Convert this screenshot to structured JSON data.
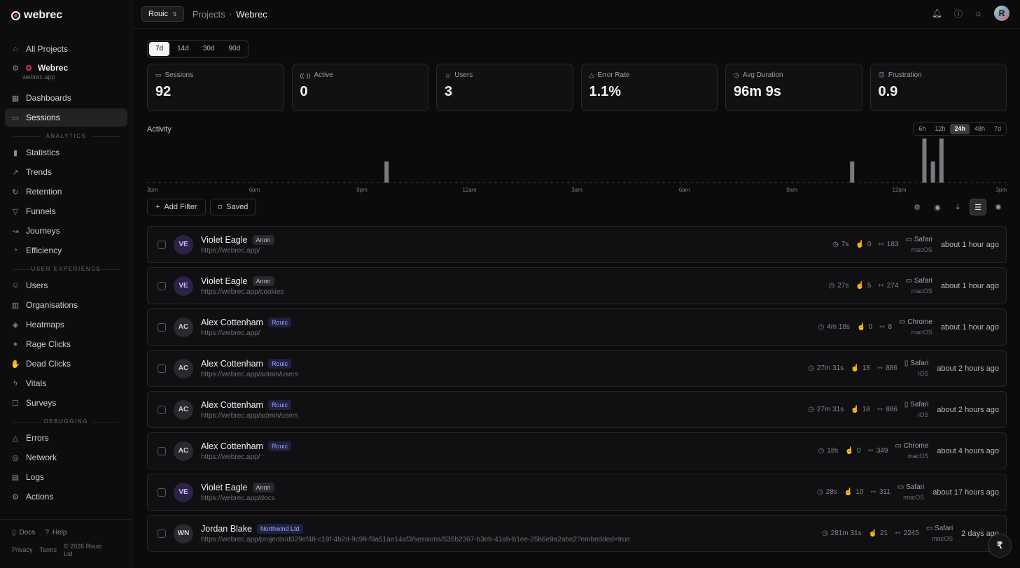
{
  "brand": {
    "name": "webrec",
    "accent": "#e0305a"
  },
  "sidebar": {
    "all_projects": "All Projects",
    "project": {
      "name": "Webrec",
      "url": "webrec.app"
    },
    "top_items": [
      {
        "label": "Dashboards",
        "icon": "grid-icon"
      },
      {
        "label": "Sessions",
        "icon": "monitor-icon",
        "active": true
      }
    ],
    "sections": [
      {
        "title": "ANALYTICS",
        "items": [
          "Statistics",
          "Trends",
          "Retention",
          "Funnels",
          "Journeys",
          "Efficiency"
        ]
      },
      {
        "title": "USER EXPERIENCE",
        "items": [
          "Users",
          "Organisations",
          "Heatmaps",
          "Rage Clicks",
          "Dead Clicks",
          "Vitals",
          "Surveys"
        ]
      },
      {
        "title": "DEBUGGING",
        "items": [
          "Errors",
          "Network",
          "Logs",
          "Actions"
        ]
      }
    ],
    "footer": {
      "docs": "Docs",
      "help": "Help",
      "privacy": "Privacy",
      "terms": "Terms",
      "copyright": "© 2026 Rouic Ltd"
    }
  },
  "topbar": {
    "org": "Rouic",
    "crumb_parent": "Projects",
    "crumb_current": "Webrec"
  },
  "ranges": [
    "7d",
    "14d",
    "30d",
    "90d"
  ],
  "range_selected": "7d",
  "stats": [
    {
      "label": "Sessions",
      "value": "92",
      "icon": "monitor-icon"
    },
    {
      "label": "Active",
      "value": "0",
      "icon": "broadcast-icon"
    },
    {
      "label": "Users",
      "value": "3",
      "icon": "user-icon"
    },
    {
      "label": "Error Rate",
      "value": "1.1%",
      "icon": "warning-icon"
    },
    {
      "label": "Avg Duration",
      "value": "96m 9s",
      "icon": "clock-icon"
    },
    {
      "label": "Frustration",
      "value": "0.9",
      "icon": "frustration-icon"
    }
  ],
  "activity": {
    "title": "Activity",
    "windows": [
      "6h",
      "12h",
      "24h",
      "48h",
      "7d"
    ],
    "window_selected": "24h"
  },
  "chart_data": {
    "type": "bar",
    "x_ticks": [
      "3pm",
      "6pm",
      "9pm",
      "12am",
      "3am",
      "6am",
      "9am",
      "12pm",
      "3pm"
    ],
    "bars": [
      {
        "pos": 0.2787,
        "value": 0.48
      },
      {
        "pos": 0.8202,
        "value": 0.48
      },
      {
        "pos": 0.9043,
        "value": 1.0
      },
      {
        "pos": 0.9142,
        "value": 0.48
      },
      {
        "pos": 0.9241,
        "value": 1.0
      }
    ]
  },
  "toolbar": {
    "add_filter": "Add Filter",
    "saved": "Saved"
  },
  "sessions": [
    {
      "initials": "VE",
      "name": "Violet Eagle",
      "badge": "Anon",
      "badge_type": "anon",
      "url": "https://webrec.app/",
      "duration": "7s",
      "clicks": "0",
      "events": "183",
      "browser": "Safari",
      "os": "macOS",
      "device": "desktop",
      "when": "about 1 hour ago"
    },
    {
      "initials": "VE",
      "name": "Violet Eagle",
      "badge": "Anon",
      "badge_type": "anon",
      "url": "https://webrec.app/cookies",
      "duration": "27s",
      "clicks": "5",
      "events": "274",
      "browser": "Safari",
      "os": "macOS",
      "device": "desktop",
      "when": "about 1 hour ago"
    },
    {
      "initials": "AC",
      "name": "Alex Cottenham",
      "badge": "Rouic",
      "badge_type": "org",
      "url": "https://webrec.app/",
      "duration": "4m 18s",
      "clicks": "0",
      "events": "8",
      "browser": "Chrome",
      "os": "macOS",
      "device": "desktop",
      "when": "about 1 hour ago"
    },
    {
      "initials": "AC",
      "name": "Alex Cottenham",
      "badge": "Rouic",
      "badge_type": "org",
      "url": "https://webrec.app/admin/users",
      "duration": "27m 31s",
      "clicks": "18",
      "events": "886",
      "browser": "Safari",
      "os": "iOS",
      "device": "mobile",
      "when": "about 2 hours ago"
    },
    {
      "initials": "AC",
      "name": "Alex Cottenham",
      "badge": "Rouic",
      "badge_type": "org",
      "url": "https://webrec.app/admin/users",
      "duration": "27m 31s",
      "clicks": "18",
      "events": "886",
      "browser": "Safari",
      "os": "iOS",
      "device": "mobile",
      "when": "about 2 hours ago"
    },
    {
      "initials": "AC",
      "name": "Alex Cottenham",
      "badge": "Rouic",
      "badge_type": "org",
      "url": "https://webrec.app/",
      "duration": "18s",
      "clicks": "0",
      "events": "349",
      "browser": "Chrome",
      "os": "macOS",
      "device": "desktop",
      "when": "about 4 hours ago"
    },
    {
      "initials": "VE",
      "name": "Violet Eagle",
      "badge": "Anon",
      "badge_type": "anon",
      "url": "https://webrec.app/docs",
      "duration": "28s",
      "clicks": "10",
      "events": "311",
      "browser": "Safari",
      "os": "macOS",
      "device": "desktop",
      "when": "about 17 hours ago"
    },
    {
      "initials": "WN",
      "name": "Jordan Blake",
      "badge": "Northwind Ltd",
      "badge_type": "org",
      "url": "https://webrec.app/projects/d029ef48-c19f-4b2d-9c99-f9a51ae14af3/sessions/535b2367-b3eb-41ab-b1ee-25b6e9a2abe2?embedded=true",
      "duration": "281m 31s",
      "clicks": "21",
      "events": "2245",
      "browser": "Safari",
      "os": "macOS",
      "device": "desktop",
      "when": "2 days ago"
    }
  ]
}
